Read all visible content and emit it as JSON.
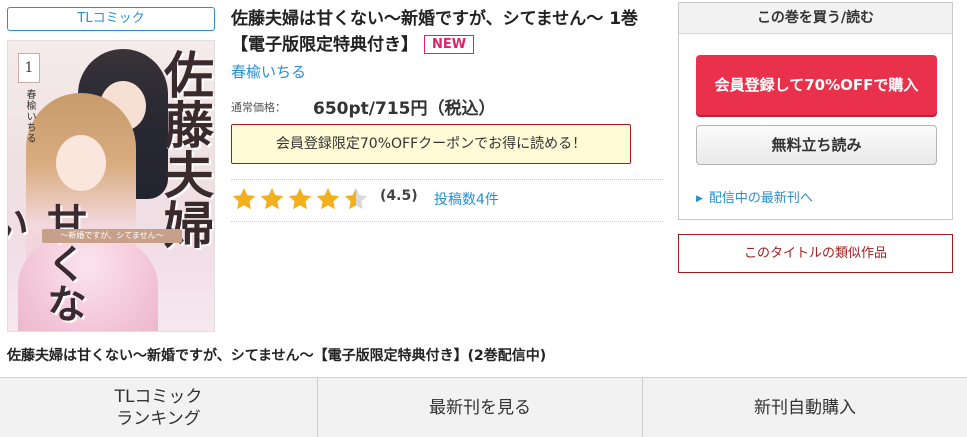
{
  "genre_tag": "TLコミック",
  "book": {
    "title": "佐藤夫婦は甘くない〜新婚ですが、シてません〜 1巻【電子版限定特典付き】",
    "new_badge": "NEW",
    "author": "春楡いちる",
    "price_label": "通常価格：",
    "price": "650pt/715円（税込）",
    "coupon_text": "会員登録限定70%OFFクーポンでお得に読める！",
    "rating": 4.5,
    "rating_text": "(4.5)",
    "review_count": "投稿数4件"
  },
  "cover": {
    "volume": "1",
    "author_vertical": "春楡いちる",
    "title_vertical_1": "佐藤夫婦",
    "title_vertical_2": "甘くない",
    "subtitle": "〜新婚ですが、シてません〜"
  },
  "buy_panel": {
    "header": "この巻を買う/読む",
    "signup_button": "会員登録して70%OFFで購入",
    "trial_button": "無料立ち読み",
    "latest_link": "配信中の最新刊へ"
  },
  "similar_button": "このタイトルの類似作品",
  "series_line": "佐藤夫婦は甘くない〜新婚ですが、シてません〜【電子版限定特典付き】(2巻配信中)",
  "bottom_nav": {
    "ranking_line1": "TLコミック",
    "ranking_line2": "ランキング",
    "latest": "最新刊を見る",
    "auto_buy": "新刊自動購入"
  },
  "colors": {
    "accent_blue": "#2a8fd0",
    "signup_red": "#e9314b",
    "new_pink": "#e0226d",
    "coupon_bg": "#fffbd6",
    "star_gold": "#f2b01e"
  }
}
